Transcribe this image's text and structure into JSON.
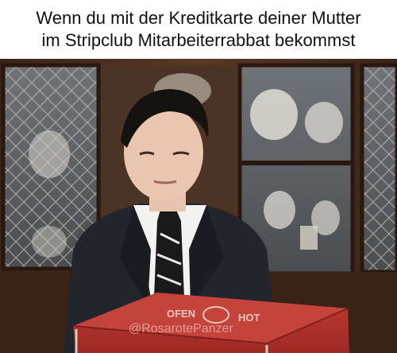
{
  "caption": {
    "line1": "Wenn du mit der Kreditkarte deiner Mutter",
    "line2": "im Stripclub Mitarbeiterrabbat bekommst"
  },
  "photo": {
    "watermark": "@RosarotePanzer",
    "box_print_left": "OFEN",
    "box_print_right": "HOT"
  }
}
